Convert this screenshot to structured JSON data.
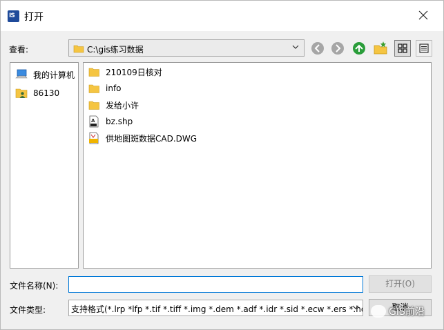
{
  "window": {
    "title": "打开"
  },
  "lookin": {
    "label": "查看:",
    "path": "C:\\gis练习数据"
  },
  "places": [
    {
      "label": "我的计算机",
      "icon": "computer-icon"
    },
    {
      "label": "86130",
      "icon": "user-folder-icon"
    }
  ],
  "files": [
    {
      "name": "210109日核对",
      "icon": "folder-icon"
    },
    {
      "name": "info",
      "icon": "folder-icon"
    },
    {
      "name": "发给小许",
      "icon": "folder-icon"
    },
    {
      "name": "bz.shp",
      "icon": "shp-file-icon"
    },
    {
      "name": "供地图斑数据CAD.DWG",
      "icon": "dwg-file-icon"
    }
  ],
  "filename": {
    "label": "文件名称(N):",
    "value": ""
  },
  "filetype": {
    "label": "文件类型:",
    "value": "支持格式(*.lrp *lfp *.tif *.tiff *.img *.dem *.adf *.idr *.sid *.ecw *.ers *.hd"
  },
  "buttons": {
    "open": "打开(O)",
    "cancel": "取消"
  },
  "watermark": "GIS前沿",
  "colors": {
    "accent": "#0078d7",
    "folder": "#f5c542",
    "nav_green": "#2a9d3a"
  }
}
